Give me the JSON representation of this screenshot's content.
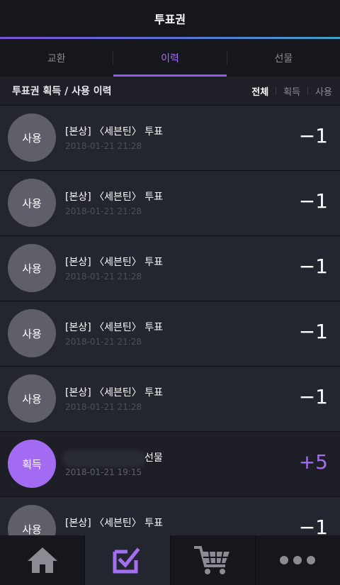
{
  "header": {
    "title": "투표권"
  },
  "tabs": [
    {
      "label": "교환",
      "active": false
    },
    {
      "label": "이력",
      "active": true
    },
    {
      "label": "선물",
      "active": false
    }
  ],
  "subheader": {
    "title": "투표권 획득 / 사용 이력",
    "filters": [
      {
        "label": "전체",
        "active": true
      },
      {
        "label": "획득",
        "active": false
      },
      {
        "label": "사용",
        "active": false
      }
    ]
  },
  "history": [
    {
      "badge": "사용",
      "title": "[본상] 〈세븐틴〉 투표",
      "date": "2018-01-21 21:28",
      "amount": "−1"
    },
    {
      "badge": "사용",
      "title": "[본상] 〈세븐틴〉 투표",
      "date": "2018-01-21 21:28",
      "amount": "−1"
    },
    {
      "badge": "사용",
      "title": "[본상] 〈세븐틴〉 투표",
      "date": "2018-01-21 21:28",
      "amount": "−1"
    },
    {
      "badge": "사용",
      "title": "[본상] 〈세븐틴〉 투표",
      "date": "2018-01-21 21:28",
      "amount": "−1"
    },
    {
      "badge": "사용",
      "title": "[본상] 〈세븐틴〉 투표",
      "date": "2018-01-21 21:28",
      "amount": "−1"
    },
    {
      "badge": "획득",
      "title": "선물",
      "date": "2018-01-21 19:15",
      "amount": "+5"
    },
    {
      "badge": "사용",
      "title": "[본상] 〈세븐틴〉 투표",
      "date": "",
      "amount": "−1"
    }
  ],
  "bottom_nav": [
    {
      "icon": "home-icon",
      "active": false
    },
    {
      "icon": "vote-check-icon",
      "active": true
    },
    {
      "icon": "cart-icon",
      "active": false
    },
    {
      "icon": "more-icon",
      "active": false
    }
  ],
  "colors": {
    "accent": "#a46ef0",
    "background": "#23252f",
    "bar": "#16171d",
    "used_badge": "#5e5f68"
  }
}
